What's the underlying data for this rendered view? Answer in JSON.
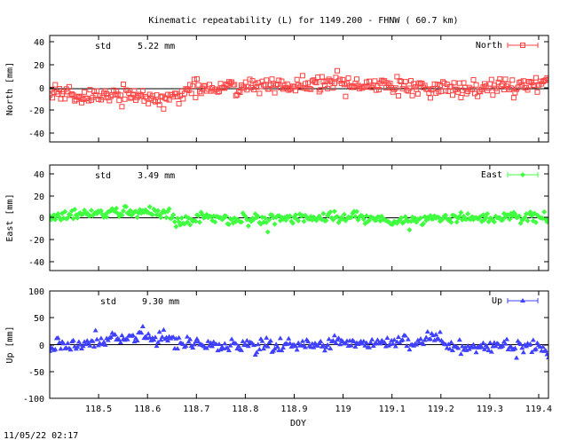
{
  "title": "Kinematic repeatability (L) for 1149.200 - FHNW  ( 60.7 km)",
  "timestamp": "11/05/22 02:17",
  "x_axis": {
    "label": "DOY",
    "range": [
      118.4,
      119.42
    ],
    "ticks": [
      "118.5",
      "118.6",
      "118.7",
      "118.8",
      "118.9",
      "119",
      "119.1",
      "119.2",
      "119.3",
      "119.4"
    ]
  },
  "chart_data": [
    {
      "type": "scatter",
      "series_name": "North",
      "ylabel": "North [mm]",
      "ylim": [
        -50,
        50
      ],
      "yticks": [
        "40",
        "20",
        "0",
        "-20",
        "-40"
      ],
      "std_label": "std",
      "std_value": "5.22 mm",
      "color": "#ff4040",
      "marker": "square",
      "std": 5.22,
      "trend_x": [
        118.4,
        118.45,
        118.5,
        118.55,
        118.6,
        118.63,
        118.66,
        118.7,
        118.75,
        118.8,
        118.85,
        118.9,
        118.95,
        119.0,
        119.05,
        119.1,
        119.15,
        119.2,
        119.25,
        119.3,
        119.35,
        119.4,
        119.42
      ],
      "trend_y": [
        -5,
        -6,
        -7,
        -4,
        -8,
        -12,
        -5,
        0,
        2,
        3,
        3,
        2,
        4,
        4,
        3,
        1,
        2,
        1,
        0,
        2,
        3,
        5,
        8
      ]
    },
    {
      "type": "scatter",
      "series_name": "East",
      "ylabel": "East [mm]",
      "ylim": [
        -50,
        50
      ],
      "yticks": [
        "40",
        "20",
        "0",
        "-20",
        "-40"
      ],
      "std_label": "std",
      "std_value": "3.49 mm",
      "color": "#40ff40",
      "marker": "diamond",
      "std": 3.49,
      "trend_x": [
        118.4,
        118.45,
        118.5,
        118.55,
        118.6,
        118.64,
        118.66,
        118.7,
        118.75,
        118.8,
        118.85,
        118.9,
        118.95,
        119.0,
        119.05,
        119.1,
        119.15,
        119.2,
        119.25,
        119.3,
        119.35,
        119.4,
        119.42
      ],
      "trend_y": [
        0,
        2,
        4,
        5,
        7,
        4,
        -2,
        -1,
        0,
        -2,
        -1,
        1,
        0,
        1,
        1,
        -4,
        -2,
        0,
        -1,
        -1,
        1,
        1,
        0
      ]
    },
    {
      "type": "scatter",
      "series_name": "Up",
      "ylabel": "Up [mm]",
      "ylim": [
        -100,
        100
      ],
      "yticks": [
        "100",
        "50",
        "0",
        "-50",
        "-100"
      ],
      "std_label": "std",
      "std_value": "9.30 mm",
      "color": "#4040ff",
      "marker": "triangle",
      "std": 9.3,
      "trend_x": [
        118.4,
        118.45,
        118.5,
        118.55,
        118.6,
        118.65,
        118.7,
        118.75,
        118.8,
        118.85,
        118.9,
        118.95,
        119.0,
        119.05,
        119.1,
        119.15,
        119.19,
        119.22,
        119.25,
        119.3,
        119.35,
        119.4,
        119.42
      ],
      "trend_y": [
        0,
        -3,
        3,
        12,
        18,
        5,
        2,
        0,
        0,
        -2,
        -3,
        3,
        5,
        0,
        3,
        5,
        18,
        -3,
        -5,
        -3,
        0,
        -5,
        -10
      ]
    }
  ]
}
